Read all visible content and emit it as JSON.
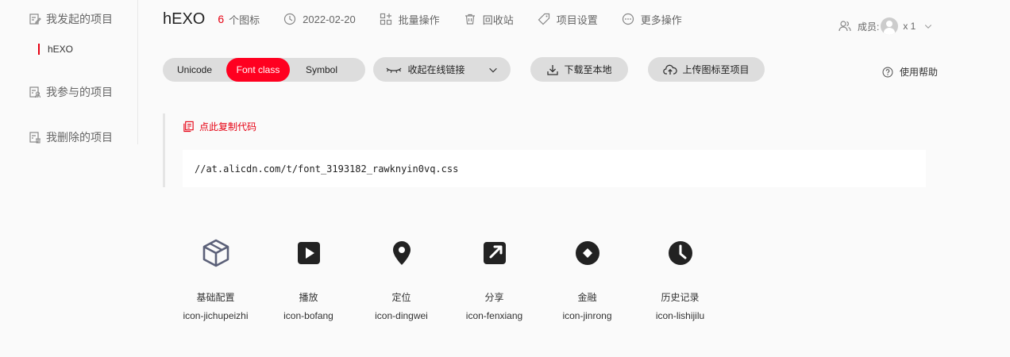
{
  "sidebar": {
    "items": [
      {
        "label": "我发起的项目",
        "icon": "edit-doc-icon"
      },
      {
        "label": "我参与的项目",
        "icon": "doc-user-icon"
      },
      {
        "label": "我删除的项目",
        "icon": "doc-trash-icon"
      }
    ],
    "active_project": "hEXO"
  },
  "header": {
    "project_name": "hEXO",
    "icon_count": "6",
    "icon_count_label": "个图标",
    "date": "2022-02-20",
    "batch_label": "批量操作",
    "recycle_label": "回收站",
    "settings_label": "项目设置",
    "more_label": "更多操作",
    "members_label": "成员:",
    "members_count": "x 1"
  },
  "toolbar": {
    "tabs": [
      "Unicode",
      "Font class",
      "Symbol"
    ],
    "active_tab": "Font class",
    "collapse_link_label": "收起在线链接",
    "download_label": "下载至本地",
    "upload_label": "上传图标至项目",
    "help_label": "使用帮助"
  },
  "code": {
    "copy_label": "点此复制代码",
    "url": "//at.alicdn.com/t/font_3193182_rawknyin0vq.css"
  },
  "icons": [
    {
      "name": "基础配置",
      "class": "icon-jichupeizhi",
      "glyph": "cube-icon"
    },
    {
      "name": "播放",
      "class": "icon-bofang",
      "glyph": "play-icon"
    },
    {
      "name": "定位",
      "class": "icon-dingwei",
      "glyph": "location-pin-icon"
    },
    {
      "name": "分享",
      "class": "icon-fenxiang",
      "glyph": "share-icon"
    },
    {
      "name": "金融",
      "class": "icon-jinrong",
      "glyph": "coin-icon"
    },
    {
      "name": "历史记录",
      "class": "icon-lishijilu",
      "glyph": "clock-icon"
    }
  ],
  "colors": {
    "accent": "#ff0020",
    "accent_text": "#e60012",
    "icon_dark": "#222222",
    "cube": "#5b6078",
    "pill_bg": "#dddddd"
  }
}
